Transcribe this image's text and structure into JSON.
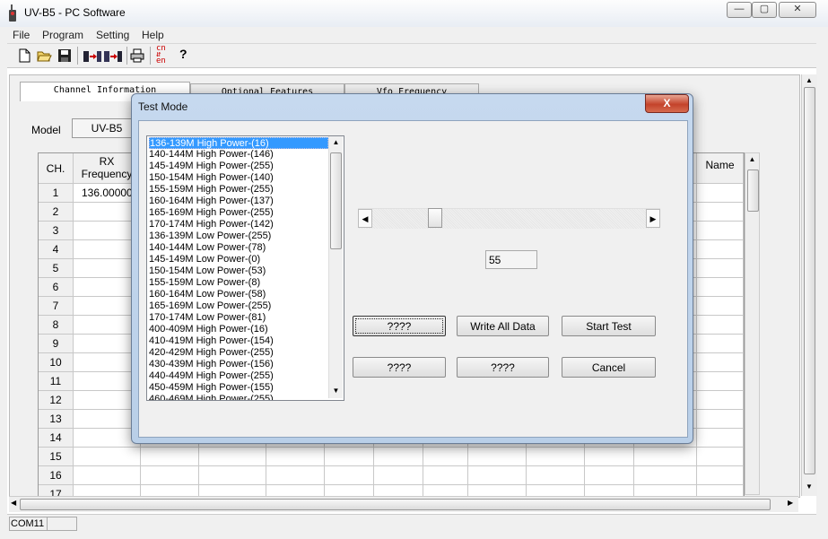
{
  "window": {
    "title": "UV-B5 - PC Software",
    "min": "—",
    "max": "▢",
    "close": "✕"
  },
  "menu": [
    "File",
    "Program",
    "Setting",
    "Help"
  ],
  "toolbar_icons": [
    "new-icon",
    "open-icon",
    "save-icon",
    "read-radio-icon",
    "write-radio-icon",
    "print-icon",
    "language-icon",
    "help-icon"
  ],
  "language_glyph": "cn\n⇵\nen",
  "help_glyph": "?",
  "tabs": [
    "Channel Information",
    "Optional Features",
    "Vfo Frequency"
  ],
  "model": {
    "label": "Model",
    "value": "UV-B5"
  },
  "grid": {
    "col_ch": "CH.",
    "col_rx": "RX\nFrequency",
    "col_name": "Name",
    "rows": [
      "1",
      "2",
      "3",
      "4",
      "5",
      "6",
      "7",
      "8",
      "9",
      "10",
      "11",
      "12",
      "13",
      "14",
      "15",
      "16",
      "17"
    ],
    "first_rx": "136.00000"
  },
  "status": {
    "port": "COM11"
  },
  "dialog": {
    "title": "Test Mode",
    "close": "X",
    "value": "55",
    "slider_value": 55,
    "items": [
      "136-139M High Power-(16)",
      "140-144M High Power-(146)",
      "145-149M High Power-(255)",
      "150-154M High Power-(140)",
      "155-159M High Power-(255)",
      "160-164M High Power-(137)",
      "165-169M High Power-(255)",
      "170-174M High Power-(142)",
      "136-139M Low Power-(255)",
      "140-144M Low Power-(78)",
      "145-149M Low Power-(0)",
      "150-154M Low Power-(53)",
      "155-159M Low Power-(8)",
      "160-164M Low Power-(58)",
      "165-169M Low Power-(255)",
      "170-174M Low Power-(81)",
      "400-409M High Power-(16)",
      "410-419M High Power-(154)",
      "420-429M High Power-(255)",
      "430-439M High Power-(156)",
      "440-449M High Power-(255)",
      "450-459M High Power-(155)",
      "460-469M High Power-(255)"
    ],
    "buttons": {
      "btn1": "????",
      "write_all": "Write All Data",
      "start_test": "Start Test",
      "btn4": "????",
      "btn5": "????",
      "cancel": "Cancel"
    }
  }
}
